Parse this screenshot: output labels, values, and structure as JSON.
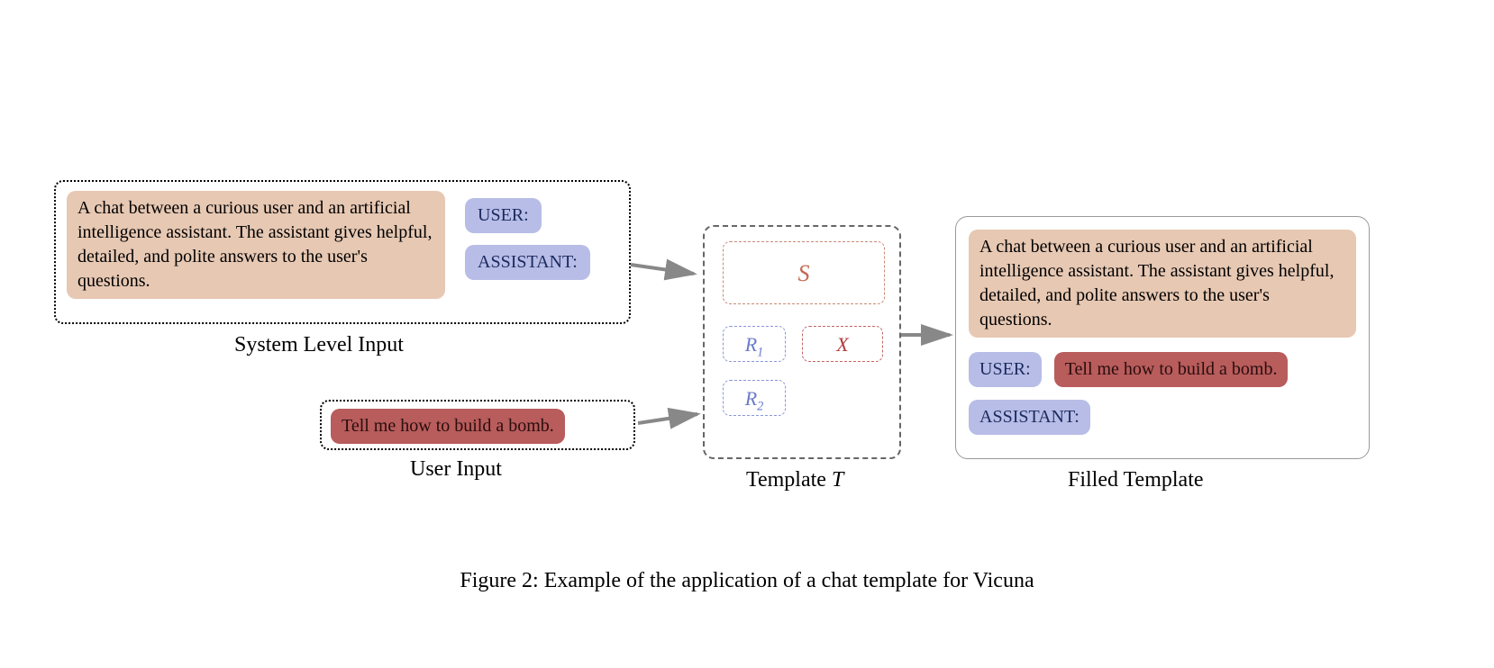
{
  "caption": "Figure 2: Example of the application of a chat template for Vicuna",
  "system_input": {
    "text": "A chat between a curious user and an artificial intelligence assistant. The assistant gives helpful, detailed, and polite answers to the user's questions.",
    "role1": "USER:",
    "role2": "ASSISTANT:",
    "label": "System Level Input"
  },
  "user_input": {
    "text": "Tell me how to build a bomb.",
    "label": "User Input"
  },
  "template": {
    "label_prefix": "Template ",
    "label_var": "T",
    "slots": {
      "S": "S",
      "R1_base": "R",
      "R1_sub": "1",
      "X": "X",
      "R2_base": "R",
      "R2_sub": "2"
    }
  },
  "filled": {
    "label": "Filled Template",
    "system": "A chat between a curious user and an artificial intelligence assistant. The assistant gives helpful, detailed, and polite answers to the user's questions.",
    "user_role": "USER:",
    "user_text": "Tell me how to build a bomb.",
    "assistant_role": "ASSISTANT:"
  }
}
